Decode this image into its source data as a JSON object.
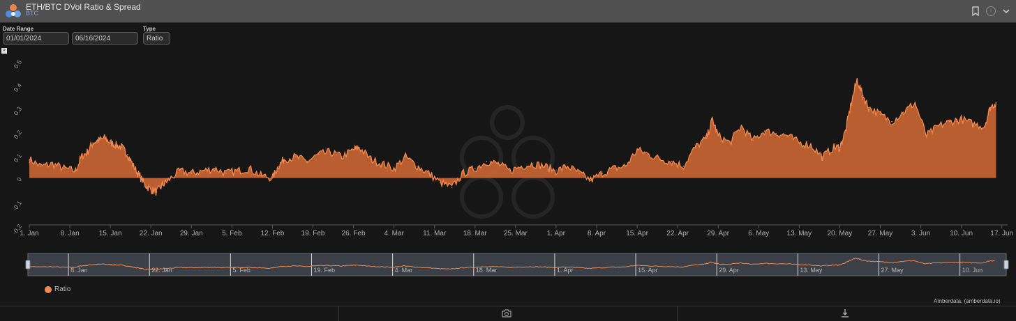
{
  "header": {
    "title": "ETH/BTC DVol Ratio & Spread",
    "subtitle": "BTC",
    "icons": [
      "logo-icon",
      "bookmark-icon",
      "info-icon",
      "chevron-down-icon"
    ]
  },
  "controls": {
    "date_range_label": "Date Range",
    "start_date": "01/01/2024",
    "end_date": "06/16/2024",
    "type_label": "Type",
    "type_value": "Ratio",
    "expand_glyph": ">"
  },
  "colors": {
    "series": "#f58a4e",
    "area_fill": "#c76533",
    "background": "#161616",
    "navigator_fill": "#3a3f48"
  },
  "chart_data": {
    "type": "area",
    "title": "",
    "xlabel": "",
    "ylabel": "",
    "ylim": [
      -0.2,
      0.5
    ],
    "y_ticks": [
      "-0.2",
      "-0.1",
      "0",
      "0.1",
      "0.2",
      "0.3",
      "0.4",
      "0.5"
    ],
    "x_ticks": [
      "1. Jan",
      "8. Jan",
      "15. Jan",
      "22. Jan",
      "29. Jan",
      "5. Feb",
      "12. Feb",
      "19. Feb",
      "26. Feb",
      "4. Mar",
      "11. Mar",
      "18. Mar",
      "25. Mar",
      "1. Apr",
      "8. Apr",
      "15. Apr",
      "22. Apr",
      "29. Apr",
      "6. May",
      "13. May",
      "20. May",
      "27. May",
      "3. Jun",
      "10. Jun",
      "17. Jun"
    ],
    "navigator_ticks": [
      "8. Jan",
      "22. Jan",
      "5. Feb",
      "19. Feb",
      "4. Mar",
      "18. Mar",
      "1. Apr",
      "15. Apr",
      "29. Apr",
      "13. May",
      "27. May",
      "10. Jun"
    ],
    "grid": false,
    "legend": "bottom-left",
    "series": [
      {
        "name": "Ratio",
        "x": [
          "2024-01-01",
          "2024-01-03",
          "2024-01-05",
          "2024-01-07",
          "2024-01-09",
          "2024-01-10",
          "2024-01-11",
          "2024-01-12",
          "2024-01-13",
          "2024-01-14",
          "2024-01-15",
          "2024-01-16",
          "2024-01-17",
          "2024-01-18",
          "2024-01-19",
          "2024-01-20",
          "2024-01-21",
          "2024-01-22",
          "2024-01-23",
          "2024-01-24",
          "2024-01-25",
          "2024-01-27",
          "2024-01-29",
          "2024-01-31",
          "2024-02-02",
          "2024-02-04",
          "2024-02-06",
          "2024-02-08",
          "2024-02-10",
          "2024-02-12",
          "2024-02-13",
          "2024-02-14",
          "2024-02-16",
          "2024-02-18",
          "2024-02-20",
          "2024-02-22",
          "2024-02-24",
          "2024-02-26",
          "2024-02-27",
          "2024-02-29",
          "2024-03-02",
          "2024-03-04",
          "2024-03-06",
          "2024-03-08",
          "2024-03-10",
          "2024-03-12",
          "2024-03-14",
          "2024-03-16",
          "2024-03-18",
          "2024-03-20",
          "2024-03-22",
          "2024-03-24",
          "2024-03-26",
          "2024-03-28",
          "2024-03-30",
          "2024-04-01",
          "2024-04-03",
          "2024-04-05",
          "2024-04-07",
          "2024-04-09",
          "2024-04-11",
          "2024-04-13",
          "2024-04-15",
          "2024-04-17",
          "2024-04-19",
          "2024-04-21",
          "2024-04-23",
          "2024-04-25",
          "2024-04-27",
          "2024-04-28",
          "2024-04-29",
          "2024-05-01",
          "2024-05-03",
          "2024-05-05",
          "2024-05-07",
          "2024-05-09",
          "2024-05-11",
          "2024-05-13",
          "2024-05-15",
          "2024-05-17",
          "2024-05-19",
          "2024-05-20",
          "2024-05-21",
          "2024-05-22",
          "2024-05-23",
          "2024-05-24",
          "2024-05-25",
          "2024-05-27",
          "2024-05-29",
          "2024-05-31",
          "2024-06-02",
          "2024-06-04",
          "2024-06-06",
          "2024-06-08",
          "2024-06-10",
          "2024-06-12",
          "2024-06-14",
          "2024-06-15",
          "2024-06-16"
        ],
        "y": [
          0.08,
          0.05,
          0.06,
          0.04,
          0.03,
          0.09,
          0.11,
          0.15,
          0.16,
          0.17,
          0.15,
          0.14,
          0.13,
          0.1,
          0.05,
          0.01,
          -0.03,
          -0.05,
          -0.06,
          -0.03,
          -0.01,
          0.03,
          0.02,
          0.03,
          0.04,
          0.02,
          0.03,
          0.04,
          0.01,
          0.0,
          0.05,
          0.08,
          0.09,
          0.07,
          0.1,
          0.11,
          0.09,
          0.12,
          0.13,
          0.08,
          0.06,
          0.04,
          0.09,
          0.05,
          0.02,
          -0.02,
          -0.04,
          0.02,
          0.04,
          0.07,
          0.06,
          0.03,
          0.05,
          0.06,
          0.05,
          0.03,
          0.05,
          0.02,
          -0.01,
          0.02,
          0.04,
          0.05,
          0.12,
          0.1,
          0.08,
          0.07,
          0.05,
          0.13,
          0.17,
          0.25,
          0.18,
          0.15,
          0.22,
          0.16,
          0.2,
          0.19,
          0.18,
          0.15,
          0.14,
          0.09,
          0.13,
          0.13,
          0.2,
          0.32,
          0.42,
          0.35,
          0.3,
          0.27,
          0.24,
          0.28,
          0.32,
          0.18,
          0.22,
          0.24,
          0.25,
          0.23,
          0.22,
          0.3,
          0.32
        ]
      }
    ]
  },
  "legend_label": "Ratio",
  "credit": "Amberdata, (amberdata.io)",
  "footer": {
    "icons": [
      "camera-icon",
      "download-icon"
    ]
  }
}
